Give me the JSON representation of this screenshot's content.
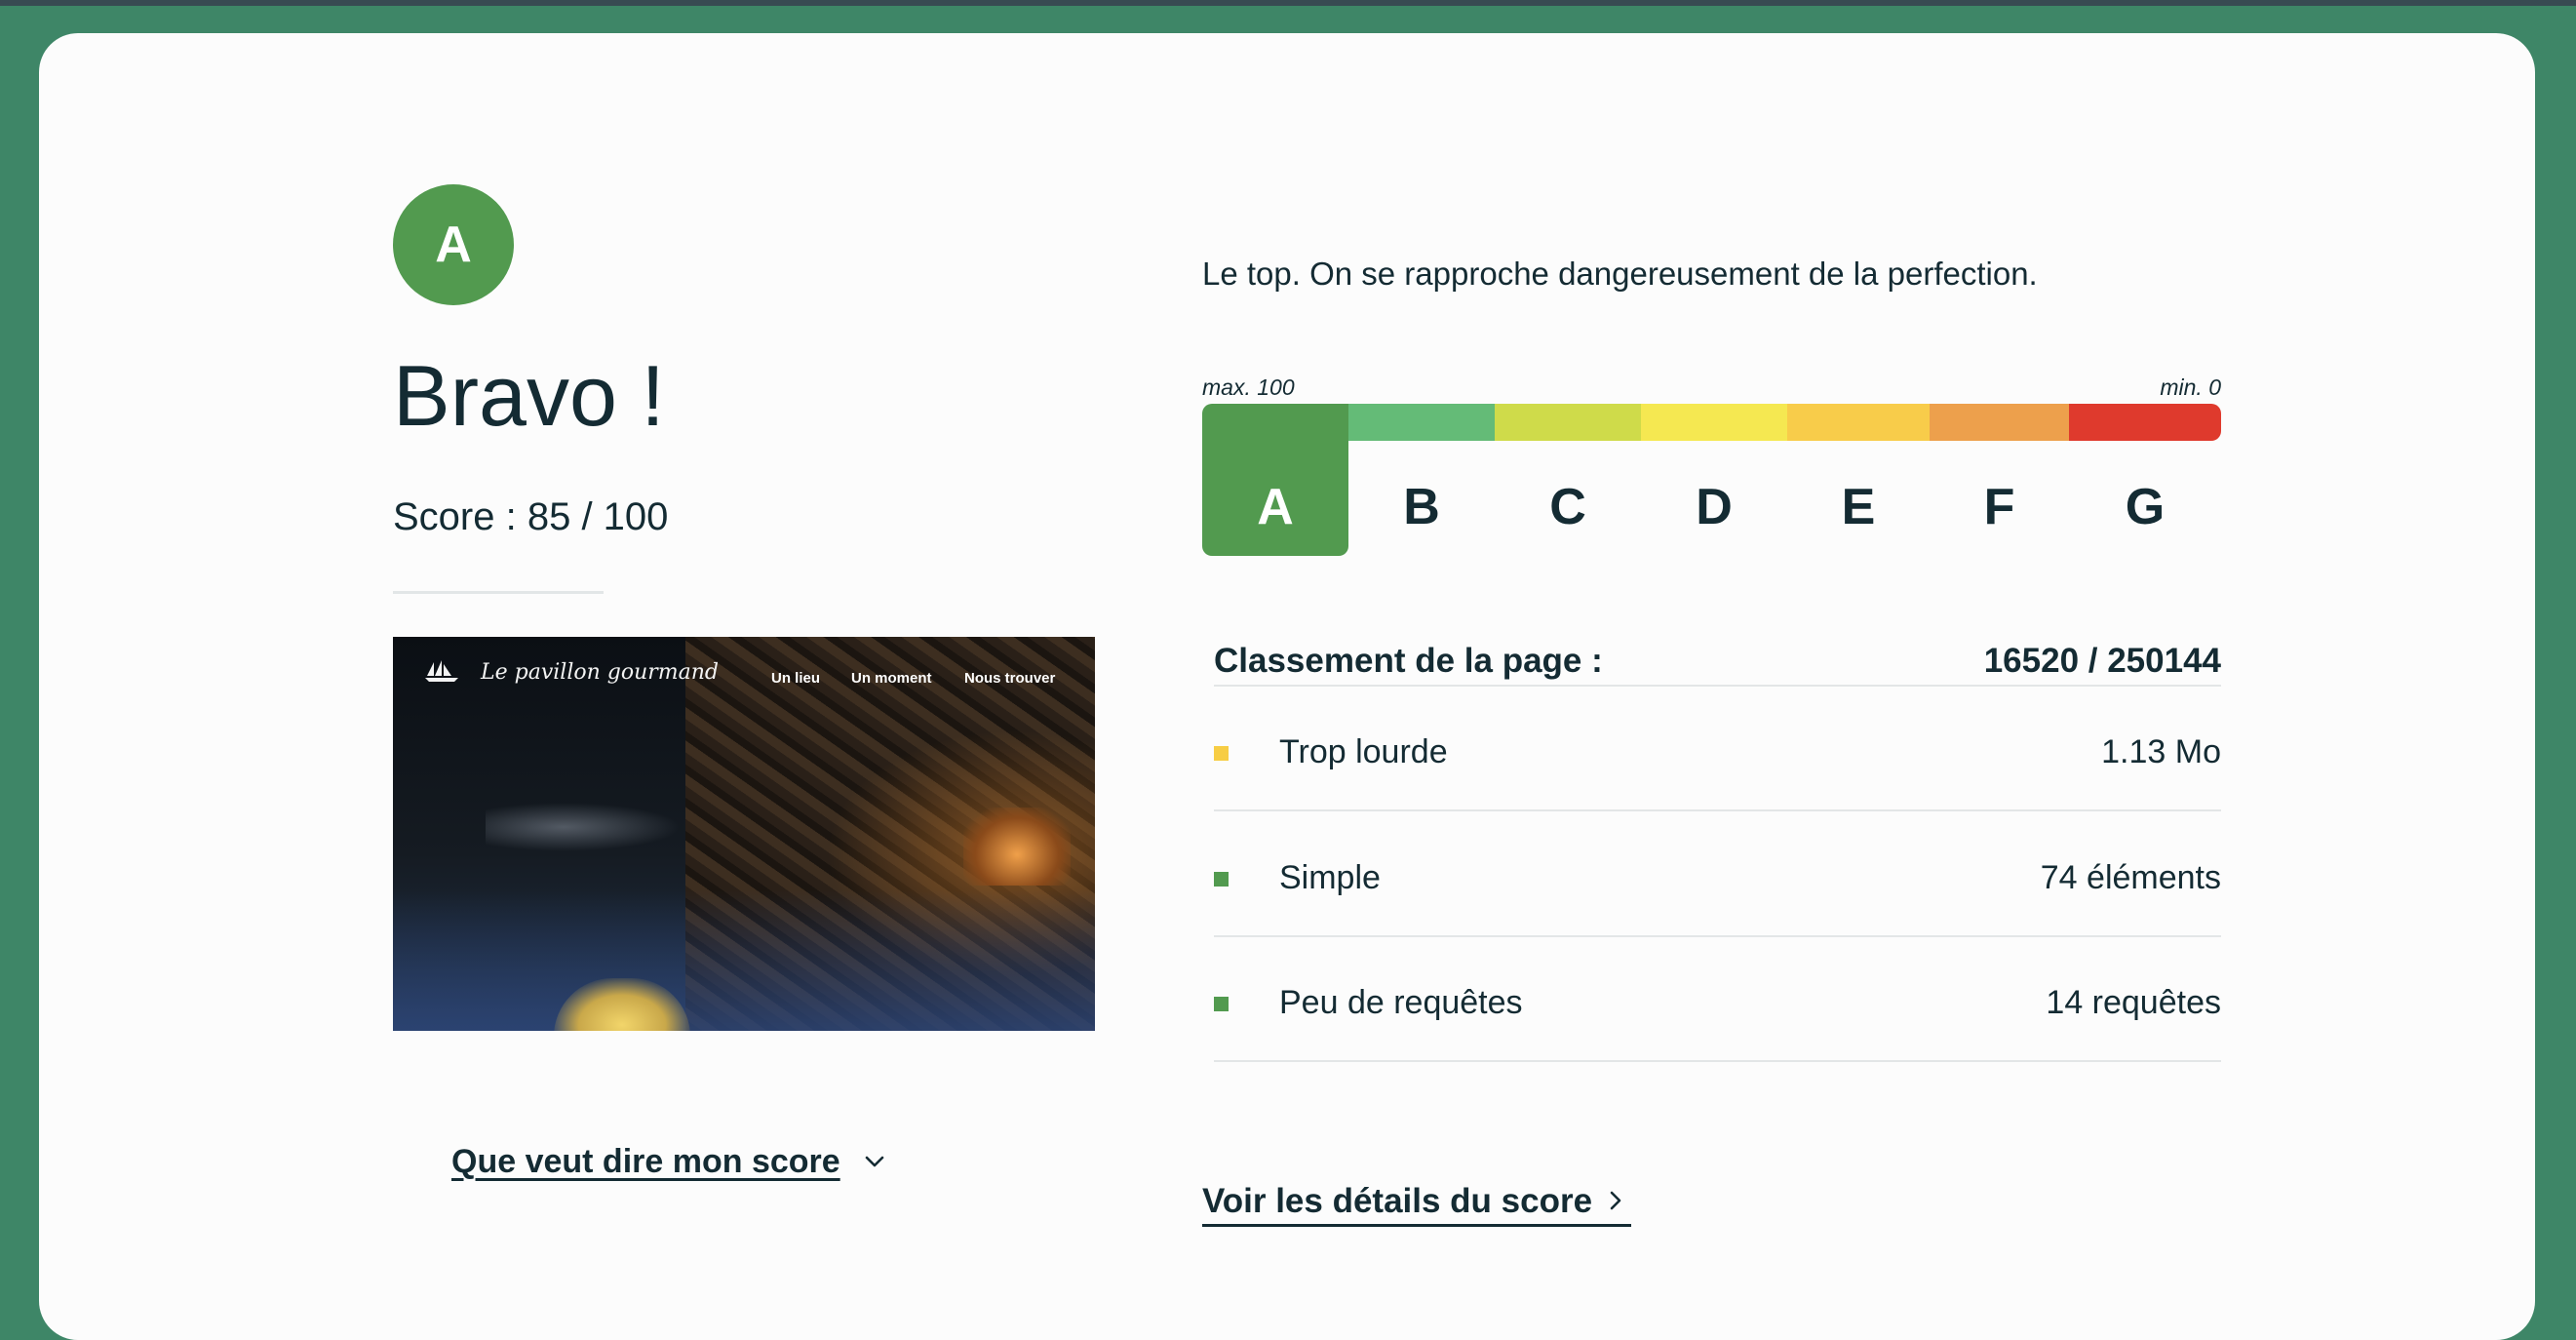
{
  "result": {
    "grade": "A",
    "heading": "Bravo !",
    "score_text": "Score : 85 / 100",
    "score": 85
  },
  "thumbnail": {
    "brand": "Le pavillon gourmand",
    "nav": [
      "Un lieu",
      "Un moment",
      "Nous trouver"
    ]
  },
  "explain_link": "Que veut dire mon score",
  "tagline": "Le top. On se rapproche dangereusement de la perfection.",
  "scale": {
    "max_label": "max. 100",
    "min_label": "min. 0",
    "active": "A",
    "grades": [
      {
        "letter": "A",
        "color": "#529a4f"
      },
      {
        "letter": "B",
        "color": "#64bb77"
      },
      {
        "letter": "C",
        "color": "#cfdb4a"
      },
      {
        "letter": "D",
        "color": "#f5e851"
      },
      {
        "letter": "E",
        "color": "#f8cc4a"
      },
      {
        "letter": "F",
        "color": "#eda04c"
      },
      {
        "letter": "G",
        "color": "#df3a2d"
      }
    ]
  },
  "ranking": {
    "label": "Classement de la page :",
    "value": "16520 / 250144"
  },
  "metrics": [
    {
      "label": "Trop lourde",
      "value": "1.13 Mo",
      "color": "#f7cd44"
    },
    {
      "label": "Simple",
      "value": "74 éléments",
      "color": "#529a4f"
    },
    {
      "label": "Peu de requêtes",
      "value": "14 requêtes",
      "color": "#529a4f"
    }
  ],
  "details_link": "Voir les détails du score"
}
